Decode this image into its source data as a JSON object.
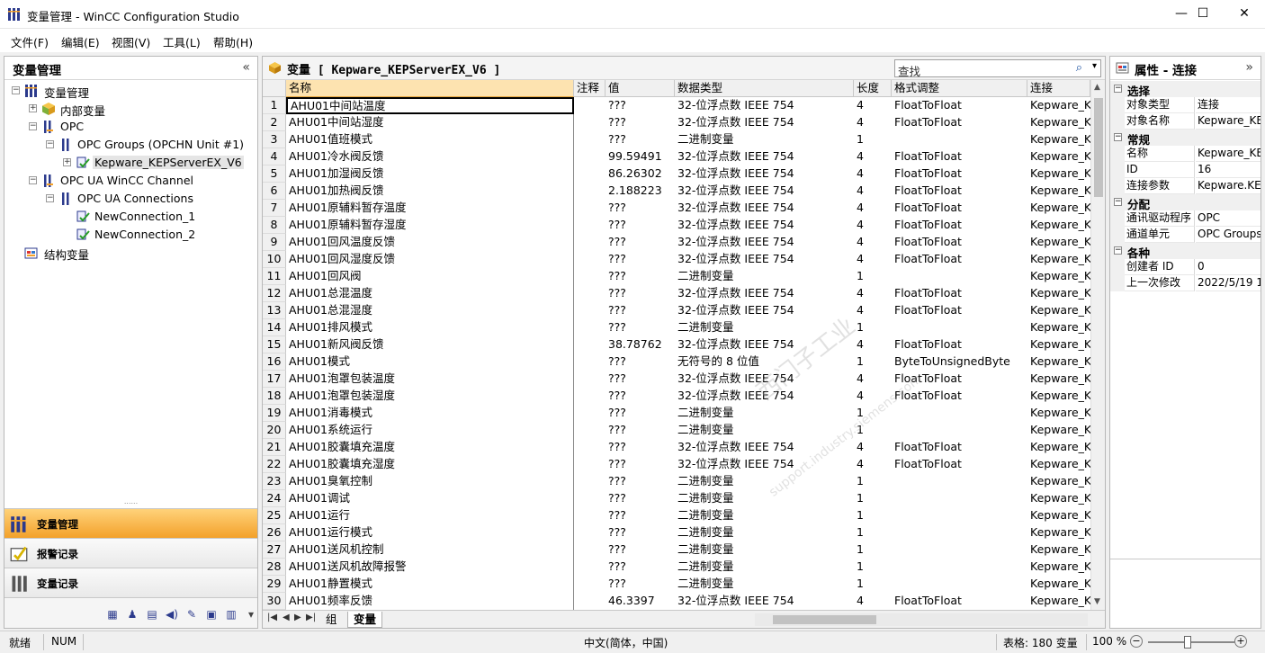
{
  "window": {
    "title": "变量管理 - WinCC Configuration Studio",
    "minimize": "—",
    "maximize": "☐",
    "close": "✕"
  },
  "menu": [
    "文件(F)",
    "编辑(E)",
    "视图(V)",
    "工具(L)",
    "帮助(H)"
  ],
  "left": {
    "title": "变量管理",
    "collapse": "«",
    "tree": [
      {
        "label": "变量管理",
        "icon": "tag-management-icon",
        "expander": "−"
      },
      {
        "label": "内部变量",
        "icon": "internal-tags-icon",
        "expander": "+"
      },
      {
        "label": "OPC",
        "icon": "driver-icon",
        "expander": "−"
      },
      {
        "label": "OPC Groups (OPCHN Unit #1)",
        "icon": "channel-unit-icon",
        "expander": "−"
      },
      {
        "label": "Kepware_KEPServerEX_V6",
        "icon": "connection-icon",
        "expander": "+",
        "selected": true
      },
      {
        "label": "OPC UA WinCC Channel",
        "icon": "driver-icon",
        "expander": "−"
      },
      {
        "label": "OPC UA Connections",
        "icon": "channel-unit-icon",
        "expander": "−"
      },
      {
        "label": "NewConnection_1",
        "icon": "connection-icon",
        "expander": ""
      },
      {
        "label": "NewConnection_2",
        "icon": "connection-icon",
        "expander": ""
      },
      {
        "label": "结构变量",
        "icon": "structure-tags-icon",
        "expander": ""
      }
    ],
    "grip": "......",
    "nav": [
      {
        "label": "变量管理",
        "icon": "tag-management-icon",
        "active": true
      },
      {
        "label": "报警记录",
        "icon": "alarm-logging-icon",
        "active": false
      },
      {
        "label": "变量记录",
        "icon": "tag-logging-icon",
        "active": false
      }
    ],
    "mini_icons": [
      "tag-icon",
      "users-icon",
      "text-icon",
      "sound-icon",
      "chart-icon",
      "picture-icon",
      "report-icon"
    ],
    "mini_glyphs": [
      "▦",
      "♟",
      "▤",
      "◀)",
      "✎",
      "▣",
      "▥"
    ],
    "mini_more": "▾"
  },
  "center": {
    "title": "变量 [ Kepware_KEPServerEX_V6 ]",
    "search_placeholder": "查找",
    "search_icon": "⌕",
    "search_dropdown": "▾",
    "columns": [
      "名称",
      "注释",
      "值",
      "数据类型",
      "长度",
      "格式调整",
      "连接"
    ],
    "rows": [
      [
        "1",
        "AHU01中间站温度",
        "",
        "???",
        "32-位浮点数 IEEE 754",
        "4",
        "FloatToFloat",
        "Kepware_KI"
      ],
      [
        "2",
        "AHU01中间站湿度",
        "",
        "???",
        "32-位浮点数 IEEE 754",
        "4",
        "FloatToFloat",
        "Kepware_KI"
      ],
      [
        "3",
        "AHU01值班模式",
        "",
        "???",
        "二进制变量",
        "1",
        "",
        "Kepware_KI"
      ],
      [
        "4",
        "AHU01冷水阀反馈",
        "",
        "99.59491",
        "32-位浮点数 IEEE 754",
        "4",
        "FloatToFloat",
        "Kepware_KI"
      ],
      [
        "5",
        "AHU01加湿阀反馈",
        "",
        "86.26302",
        "32-位浮点数 IEEE 754",
        "4",
        "FloatToFloat",
        "Kepware_KI"
      ],
      [
        "6",
        "AHU01加热阀反馈",
        "",
        "2.188223",
        "32-位浮点数 IEEE 754",
        "4",
        "FloatToFloat",
        "Kepware_KI"
      ],
      [
        "7",
        "AHU01原辅料暂存温度",
        "",
        "???",
        "32-位浮点数 IEEE 754",
        "4",
        "FloatToFloat",
        "Kepware_KI"
      ],
      [
        "8",
        "AHU01原辅料暂存湿度",
        "",
        "???",
        "32-位浮点数 IEEE 754",
        "4",
        "FloatToFloat",
        "Kepware_KI"
      ],
      [
        "9",
        "AHU01回风温度反馈",
        "",
        "???",
        "32-位浮点数 IEEE 754",
        "4",
        "FloatToFloat",
        "Kepware_KI"
      ],
      [
        "10",
        "AHU01回风湿度反馈",
        "",
        "???",
        "32-位浮点数 IEEE 754",
        "4",
        "FloatToFloat",
        "Kepware_KI"
      ],
      [
        "11",
        "AHU01回风阀",
        "",
        "???",
        "二进制变量",
        "1",
        "",
        "Kepware_KI"
      ],
      [
        "12",
        "AHU01总混温度",
        "",
        "???",
        "32-位浮点数 IEEE 754",
        "4",
        "FloatToFloat",
        "Kepware_KI"
      ],
      [
        "13",
        "AHU01总混湿度",
        "",
        "???",
        "32-位浮点数 IEEE 754",
        "4",
        "FloatToFloat",
        "Kepware_KI"
      ],
      [
        "14",
        "AHU01排风模式",
        "",
        "???",
        "二进制变量",
        "1",
        "",
        "Kepware_KI"
      ],
      [
        "15",
        "AHU01新风阀反馈",
        "",
        "38.78762",
        "32-位浮点数 IEEE 754",
        "4",
        "FloatToFloat",
        "Kepware_KI"
      ],
      [
        "16",
        "AHU01模式",
        "",
        "???",
        "无符号的 8 位值",
        "1",
        "ByteToUnsignedByte",
        "Kepware_KI"
      ],
      [
        "17",
        "AHU01泡罩包装温度",
        "",
        "???",
        "32-位浮点数 IEEE 754",
        "4",
        "FloatToFloat",
        "Kepware_KI"
      ],
      [
        "18",
        "AHU01泡罩包装湿度",
        "",
        "???",
        "32-位浮点数 IEEE 754",
        "4",
        "FloatToFloat",
        "Kepware_KI"
      ],
      [
        "19",
        "AHU01消毒模式",
        "",
        "???",
        "二进制变量",
        "1",
        "",
        "Kepware_KI"
      ],
      [
        "20",
        "AHU01系统运行",
        "",
        "???",
        "二进制变量",
        "1",
        "",
        "Kepware_KI"
      ],
      [
        "21",
        "AHU01胶囊填充温度",
        "",
        "???",
        "32-位浮点数 IEEE 754",
        "4",
        "FloatToFloat",
        "Kepware_KI"
      ],
      [
        "22",
        "AHU01胶囊填充湿度",
        "",
        "???",
        "32-位浮点数 IEEE 754",
        "4",
        "FloatToFloat",
        "Kepware_KI"
      ],
      [
        "23",
        "AHU01臭氧控制",
        "",
        "???",
        "二进制变量",
        "1",
        "",
        "Kepware_KI"
      ],
      [
        "24",
        "AHU01调试",
        "",
        "???",
        "二进制变量",
        "1",
        "",
        "Kepware_KI"
      ],
      [
        "25",
        "AHU01运行",
        "",
        "???",
        "二进制变量",
        "1",
        "",
        "Kepware_KI"
      ],
      [
        "26",
        "AHU01运行模式",
        "",
        "???",
        "二进制变量",
        "1",
        "",
        "Kepware_KI"
      ],
      [
        "27",
        "AHU01送风机控制",
        "",
        "???",
        "二进制变量",
        "1",
        "",
        "Kepware_KI"
      ],
      [
        "28",
        "AHU01送风机故障报警",
        "",
        "???",
        "二进制变量",
        "1",
        "",
        "Kepware_KI"
      ],
      [
        "29",
        "AHU01静置模式",
        "",
        "???",
        "二进制变量",
        "1",
        "",
        "Kepware_KI"
      ],
      [
        "30",
        "AHU01频率反馈",
        "",
        "46.3397",
        "32-位浮点数 IEEE 754",
        "4",
        "FloatToFloat",
        "Kepware_KI"
      ]
    ],
    "tabs": [
      "组",
      "变量"
    ],
    "nav_arrows": [
      "|◀",
      "◀",
      "▶",
      "▶|"
    ],
    "watermark": "西门子工业",
    "watermark_url": "support.industry.siemens.com",
    "scroll_up": "▲",
    "scroll_down": "▼"
  },
  "right": {
    "title": "属性 - 连接",
    "collapse": "»",
    "sections": [
      {
        "name": "选择",
        "items": [
          [
            "对象类型",
            "连接"
          ],
          [
            "对象名称",
            "Kepware_KEP"
          ]
        ]
      },
      {
        "name": "常规",
        "items": [
          [
            "名称",
            "Kepware_KEP"
          ],
          [
            "ID",
            "16"
          ],
          [
            "连接参数",
            "Kepware.KEP"
          ]
        ]
      },
      {
        "name": "分配",
        "items": [
          [
            "通讯驱动程序",
            "OPC"
          ],
          [
            "通道单元",
            "OPC Groups"
          ]
        ]
      },
      {
        "name": "各种",
        "items": [
          [
            "创建者 ID",
            "0"
          ],
          [
            "上一次修改",
            "2022/5/19 1"
          ]
        ]
      }
    ],
    "expander": "−"
  },
  "status": {
    "left": "就绪",
    "num": "NUM",
    "ime": "中文(简体，中国)",
    "count": "表格: 180 变量",
    "zoom": "100 %",
    "zoom_minus": "−",
    "zoom_plus": "+"
  },
  "colors": {
    "nav_active": "#f3a12a",
    "header_active": "#fde3b0",
    "selection": "#e5e5e5"
  }
}
